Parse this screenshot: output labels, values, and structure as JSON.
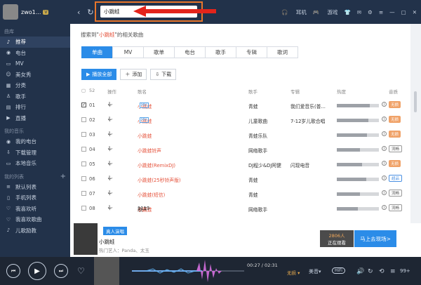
{
  "app": {
    "username": "zwo1...",
    "vip": "V"
  },
  "sidebar": {
    "sections": [
      {
        "title": "曲库",
        "items": [
          {
            "label": "推荐",
            "icon": "♪",
            "active": true
          },
          {
            "label": "电台",
            "icon": "◉"
          },
          {
            "label": "MV",
            "icon": "▭"
          },
          {
            "label": "美女秀",
            "icon": "☺"
          },
          {
            "label": "分类",
            "icon": "▦"
          },
          {
            "label": "歌手",
            "icon": "♙"
          },
          {
            "label": "排行",
            "icon": "▤"
          },
          {
            "label": "直播",
            "icon": "▶"
          }
        ]
      },
      {
        "title": "我的音乐",
        "items": [
          {
            "label": "我的电台",
            "icon": "◉"
          },
          {
            "label": "下载管理",
            "icon": "⇩"
          },
          {
            "label": "本地音乐",
            "icon": "▭"
          }
        ]
      },
      {
        "title": "我的列表",
        "items": [
          {
            "label": "默认列表",
            "icon": "≡"
          },
          {
            "label": "手机列表",
            "icon": "▯"
          },
          {
            "label": "我喜欢听",
            "icon": "♡"
          },
          {
            "label": "我喜欢歌曲",
            "icon": "♡"
          },
          {
            "label": "儿歌励教",
            "icon": "♪"
          }
        ]
      }
    ]
  },
  "topbar": {
    "search_value": "小跳蛙",
    "right_items": [
      "耳机",
      "游戏"
    ]
  },
  "main": {
    "result_prefix": "搜索到\"",
    "result_keyword": "小跳蛙",
    "result_suffix": "\"的相关歌曲",
    "tabs": [
      "单曲",
      "MV",
      "歌单",
      "电台",
      "歌手",
      "专辑",
      "歌词"
    ],
    "actions": {
      "play_all": "播放全部",
      "add": "添加",
      "download": "下载"
    },
    "headers": {
      "count": "52",
      "ops": "操作",
      "name": "歌名",
      "singer": "歌手",
      "album": "专辑",
      "heat": "热度",
      "quality": "音质"
    },
    "rows": [
      {
        "no": "01",
        "checked": true,
        "prefix": "",
        "name": "小跳蛙",
        "mv": "MV",
        "singer": "青蛙",
        "album": "我们爱音乐(普...",
        "heat": 0.78,
        "badge": "无损",
        "badge_type": "orange"
      },
      {
        "no": "02",
        "checked": false,
        "prefix": "",
        "name": "小跳蛙",
        "mv": "MV",
        "singer": "儿童歌曲",
        "album": "7-12岁儿歌合唱",
        "heat": 0.75,
        "badge": "无损",
        "badge_type": "orange"
      },
      {
        "no": "03",
        "checked": false,
        "prefix": "",
        "name": "小跳蛙",
        "mv": "",
        "singer": "青蛙乐队",
        "album": "",
        "heat": 0.72,
        "badge": "无损",
        "badge_type": "orange"
      },
      {
        "no": "04",
        "checked": false,
        "prefix": "",
        "name": "小跳蛙铃声",
        "mv": "",
        "singer": "网络歌手",
        "album": "",
        "heat": 0.55,
        "badge": "流畅",
        "badge_type": "gray"
      },
      {
        "no": "05",
        "checked": false,
        "prefix": "",
        "name": "小跳蛙(RemixDJ)",
        "mv": "",
        "singer": "DJ程少&DJ阿健",
        "album": "闪现电音",
        "heat": 0.6,
        "badge": "无损",
        "badge_type": "orange"
      },
      {
        "no": "06",
        "checked": false,
        "prefix": "",
        "name": "小跳蛙(25秒铃声版)",
        "mv": "",
        "singer": "青蛙",
        "album": "",
        "heat": 0.7,
        "badge": "超品",
        "badge_type": "blue"
      },
      {
        "no": "07",
        "checked": false,
        "prefix": "",
        "name": "小跳蛙(短信)",
        "mv": "",
        "singer": "青蛙",
        "album": "",
        "heat": 0.55,
        "badge": "流畅",
        "badge_type": "gray"
      },
      {
        "no": "08",
        "checked": false,
        "prefix": "歌声 ",
        "name": "小跳蛙",
        "suffix": " 1119",
        "mv": "",
        "singer": "网络歌手",
        "album": "",
        "heat": 0.5,
        "badge": "流畅",
        "badge_type": "gray"
      }
    ]
  },
  "promo": {
    "tag": "真人演唱",
    "title": "小跳蛙",
    "subtitle": "热门艺人：Panda、太玉",
    "count": "2806人",
    "count_label": "正在观看",
    "go": "马上去现场>"
  },
  "player": {
    "time": "00:27 / 02:31",
    "quality": "无损",
    "effect": "美音",
    "hifi": "HiFi",
    "count": "99+"
  }
}
